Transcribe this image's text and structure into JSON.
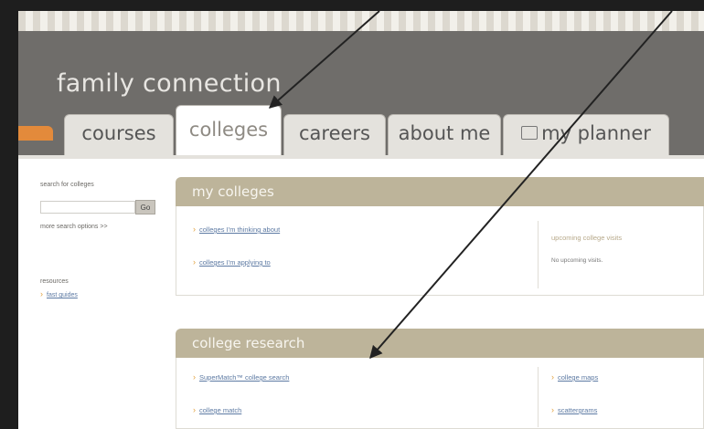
{
  "app": {
    "title": "family connection"
  },
  "tabs": [
    {
      "label": "courses"
    },
    {
      "label": "colleges"
    },
    {
      "label": "careers"
    },
    {
      "label": "about me"
    },
    {
      "label": "my planner"
    }
  ],
  "sidebar": {
    "search_label": "search for colleges",
    "go_label": "Go",
    "more_options": "more search options >>",
    "resources_label": "resources",
    "resources_link": "fast guides"
  },
  "my_colleges": {
    "title": "my colleges",
    "links": [
      "colleges I'm thinking about",
      "colleges I'm applying to"
    ],
    "upcoming_title": "upcoming college visits",
    "upcoming_text": "No upcoming visits."
  },
  "college_research": {
    "title": "college research",
    "left_links": [
      "SuperMatch™ college search",
      "college match"
    ],
    "right_links": [
      "college maps",
      "scattergrams"
    ]
  },
  "colors": {
    "header_bg": "#6f6d6a",
    "panel_head": "#bdb49a",
    "accent_orange": "#e38a3b",
    "link": "#5d7aa3",
    "annotation_arrow": "#222222"
  },
  "icons": {
    "planner": "planner-icon",
    "bullet": "chevron-right-icon"
  }
}
